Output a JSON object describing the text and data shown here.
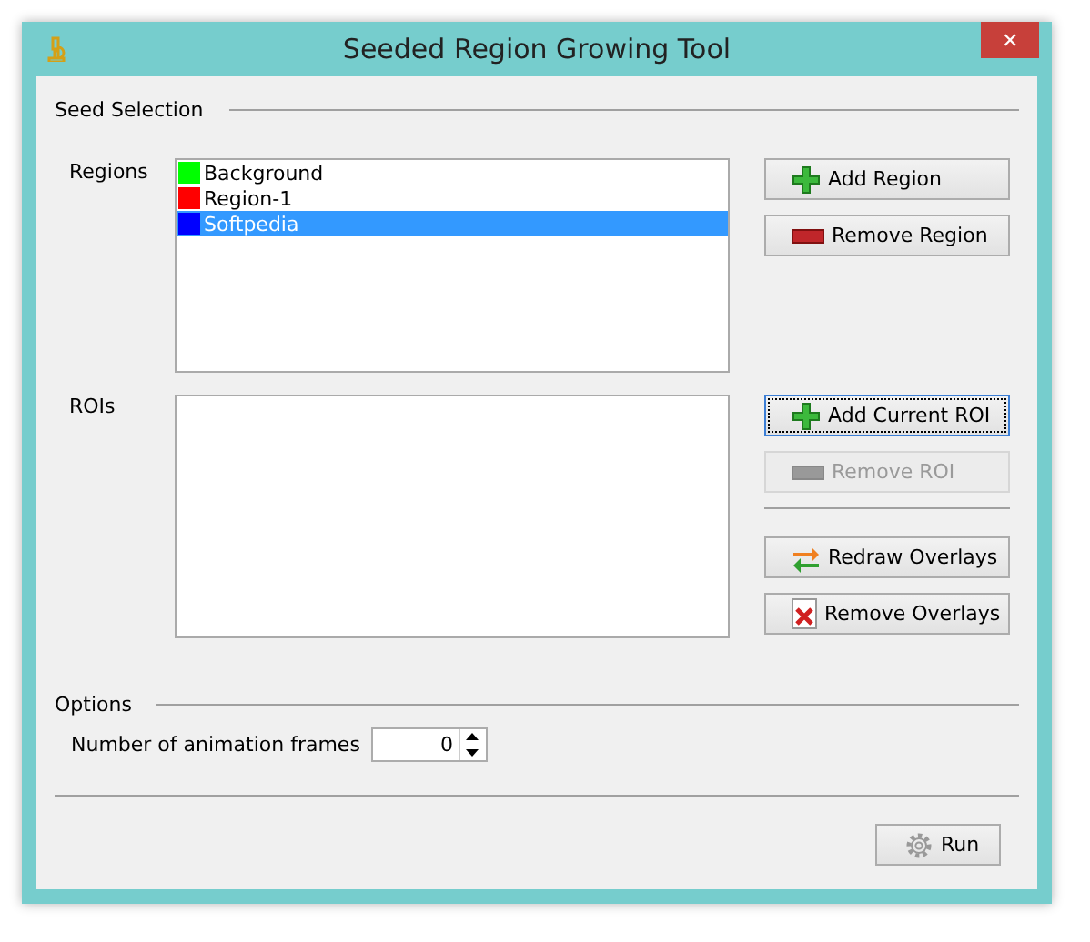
{
  "window": {
    "title": "Seeded Region Growing Tool",
    "close": "✕"
  },
  "seed_selection": {
    "title": "Seed Selection",
    "regions": {
      "label": "Regions",
      "items": [
        {
          "name": "Background",
          "color": "#00ff00",
          "selected": false
        },
        {
          "name": "Region-1",
          "color": "#ff0000",
          "selected": false
        },
        {
          "name": "Softpedia",
          "color": "#0000ff",
          "selected": true
        }
      ]
    },
    "region_buttons": [
      {
        "label": "Add Region",
        "kind": "add",
        "disabled": false,
        "focused": false
      },
      {
        "label": "Remove Region",
        "kind": "remove",
        "disabled": false,
        "focused": false
      }
    ],
    "rois": {
      "label": "ROIs"
    },
    "roi_buttons": [
      {
        "label": "Add Current ROI",
        "kind": "add",
        "disabled": false,
        "focused": true
      },
      {
        "label": "Remove ROI",
        "kind": "remove",
        "disabled": true,
        "focused": false
      }
    ],
    "overlay_buttons": [
      {
        "label": "Redraw Overlays",
        "kind": "redraw",
        "disabled": false,
        "focused": false
      },
      {
        "label": "Remove Overlays",
        "kind": "delete",
        "disabled": false,
        "focused": false
      }
    ]
  },
  "options": {
    "title": "Options",
    "frames_label": "Number of animation frames",
    "frames_value": "0"
  },
  "run_button": {
    "label": "Run",
    "kind": "gear",
    "disabled": false,
    "focused": false
  }
}
